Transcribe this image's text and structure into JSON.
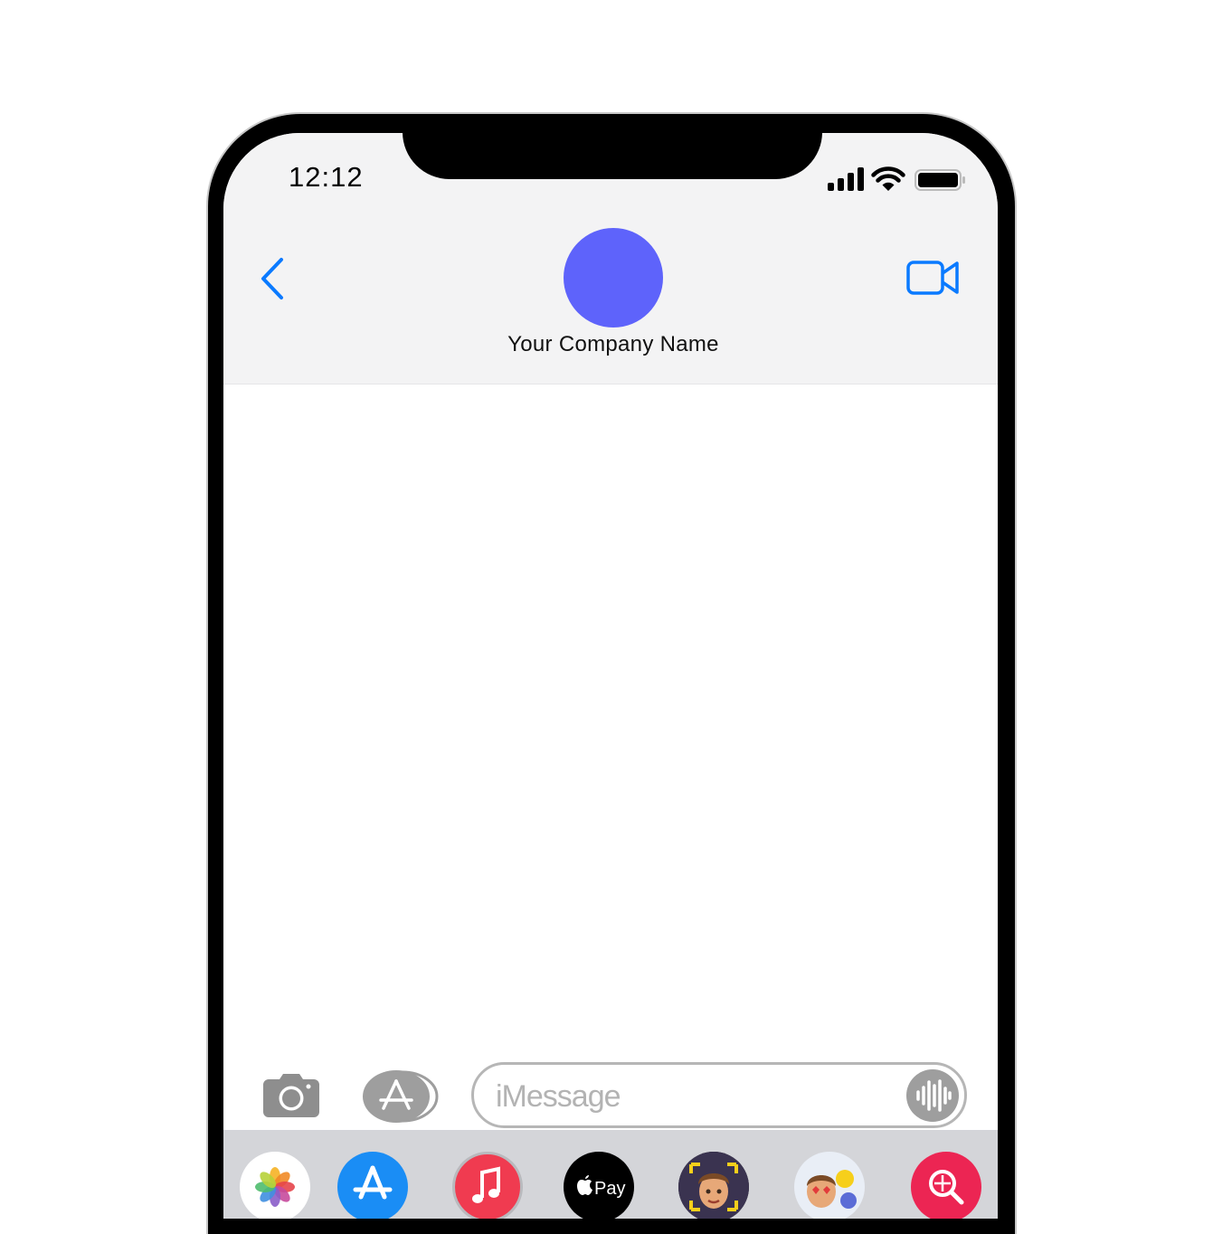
{
  "status_bar": {
    "time": "12:12",
    "icons": [
      "cellular-signal-icon",
      "wifi-icon",
      "battery-icon"
    ]
  },
  "header": {
    "back_icon": "chevron-left-icon",
    "contact_name": "Your Company Name",
    "avatar_color": "#5E63FB",
    "video_icon": "video-camera-icon"
  },
  "compose": {
    "placeholder": "iMessage",
    "value": "",
    "camera_icon": "camera-icon",
    "apps_icon": "app-store-icon",
    "audio_icon": "audio-waveform-icon"
  },
  "app_drawer": {
    "apps": [
      "Photos",
      "App Store",
      "Music",
      "Apple Pay",
      "Memoji",
      "Memoji Stickers",
      "Search"
    ]
  },
  "colors": {
    "accent": "#0A7AFF",
    "header_bg": "#F3F3F4",
    "drawer_bg": "#D4D5D9"
  }
}
